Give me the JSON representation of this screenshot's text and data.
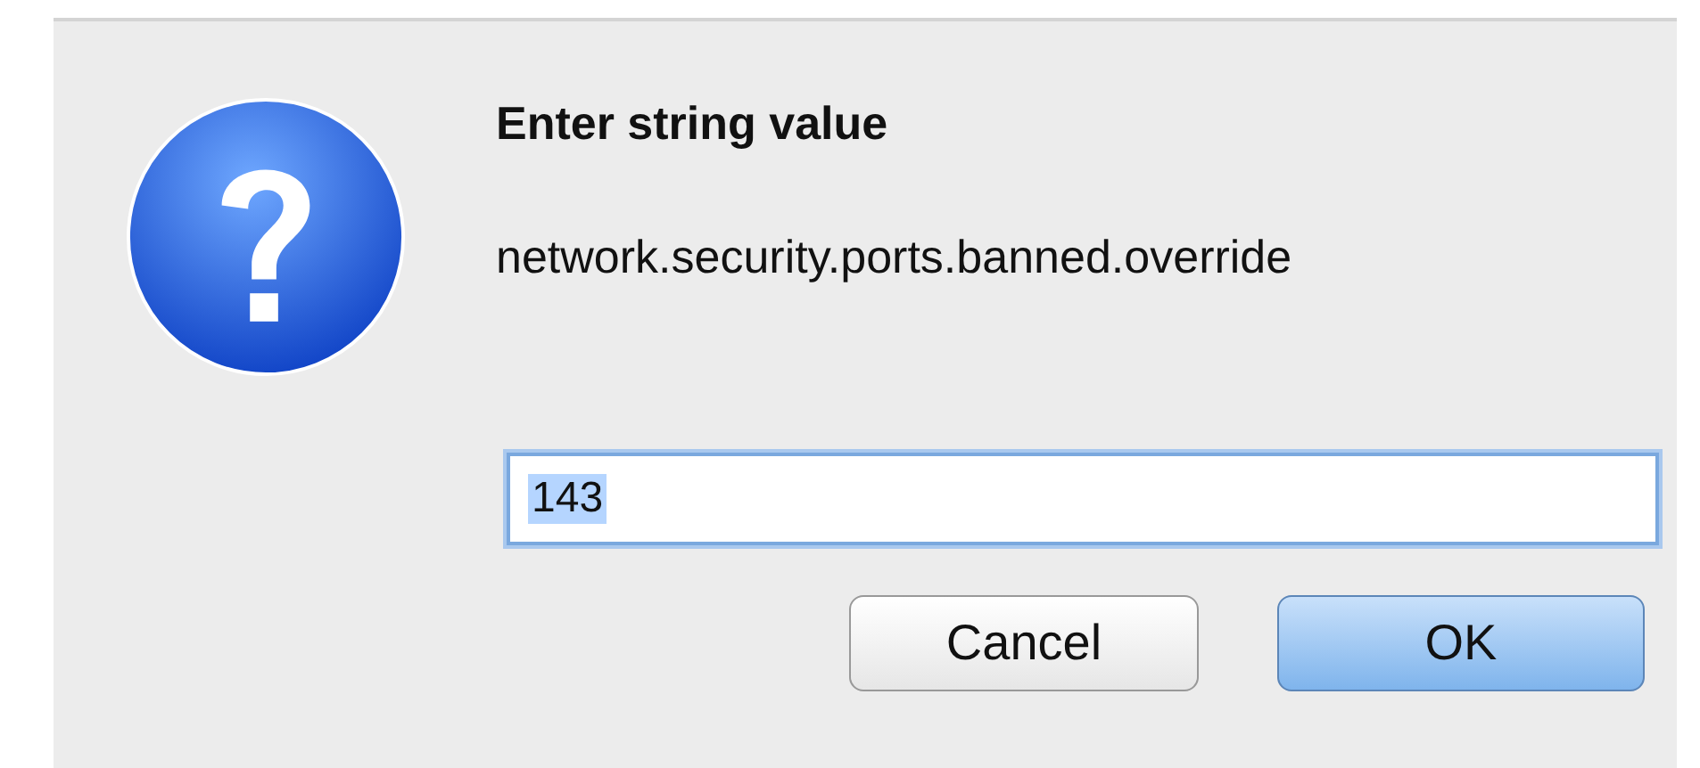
{
  "dialog": {
    "title": "Enter string value",
    "message": "network.security.ports.banned.override",
    "field": {
      "value": "143",
      "value_selected": true
    },
    "buttons": [
      {
        "label": "Cancel",
        "default": false
      },
      {
        "label": "OK",
        "default": true
      }
    ]
  }
}
